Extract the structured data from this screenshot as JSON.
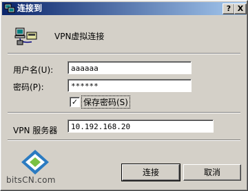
{
  "window": {
    "title": "连接到",
    "help_button": "?",
    "close_button": "X"
  },
  "connection": {
    "name": "VPN虚拟连接"
  },
  "form": {
    "username_label": "用户名(U):",
    "username_value": "aaaaaa",
    "password_label": "密码(P):",
    "password_value": "******",
    "save_password_label": "保存密码(S)",
    "save_password_checked": true,
    "vpn_server_label": "VPN 服务器",
    "vpn_server_value": "10.192.168.20"
  },
  "buttons": {
    "connect": "连接",
    "cancel": "取消"
  },
  "watermark": {
    "text": "bitsCN.com"
  },
  "colors": {
    "titlebar_start": "#0a246a",
    "titlebar_end": "#a6caf0",
    "dialog_bg": "#d4d0c8"
  }
}
